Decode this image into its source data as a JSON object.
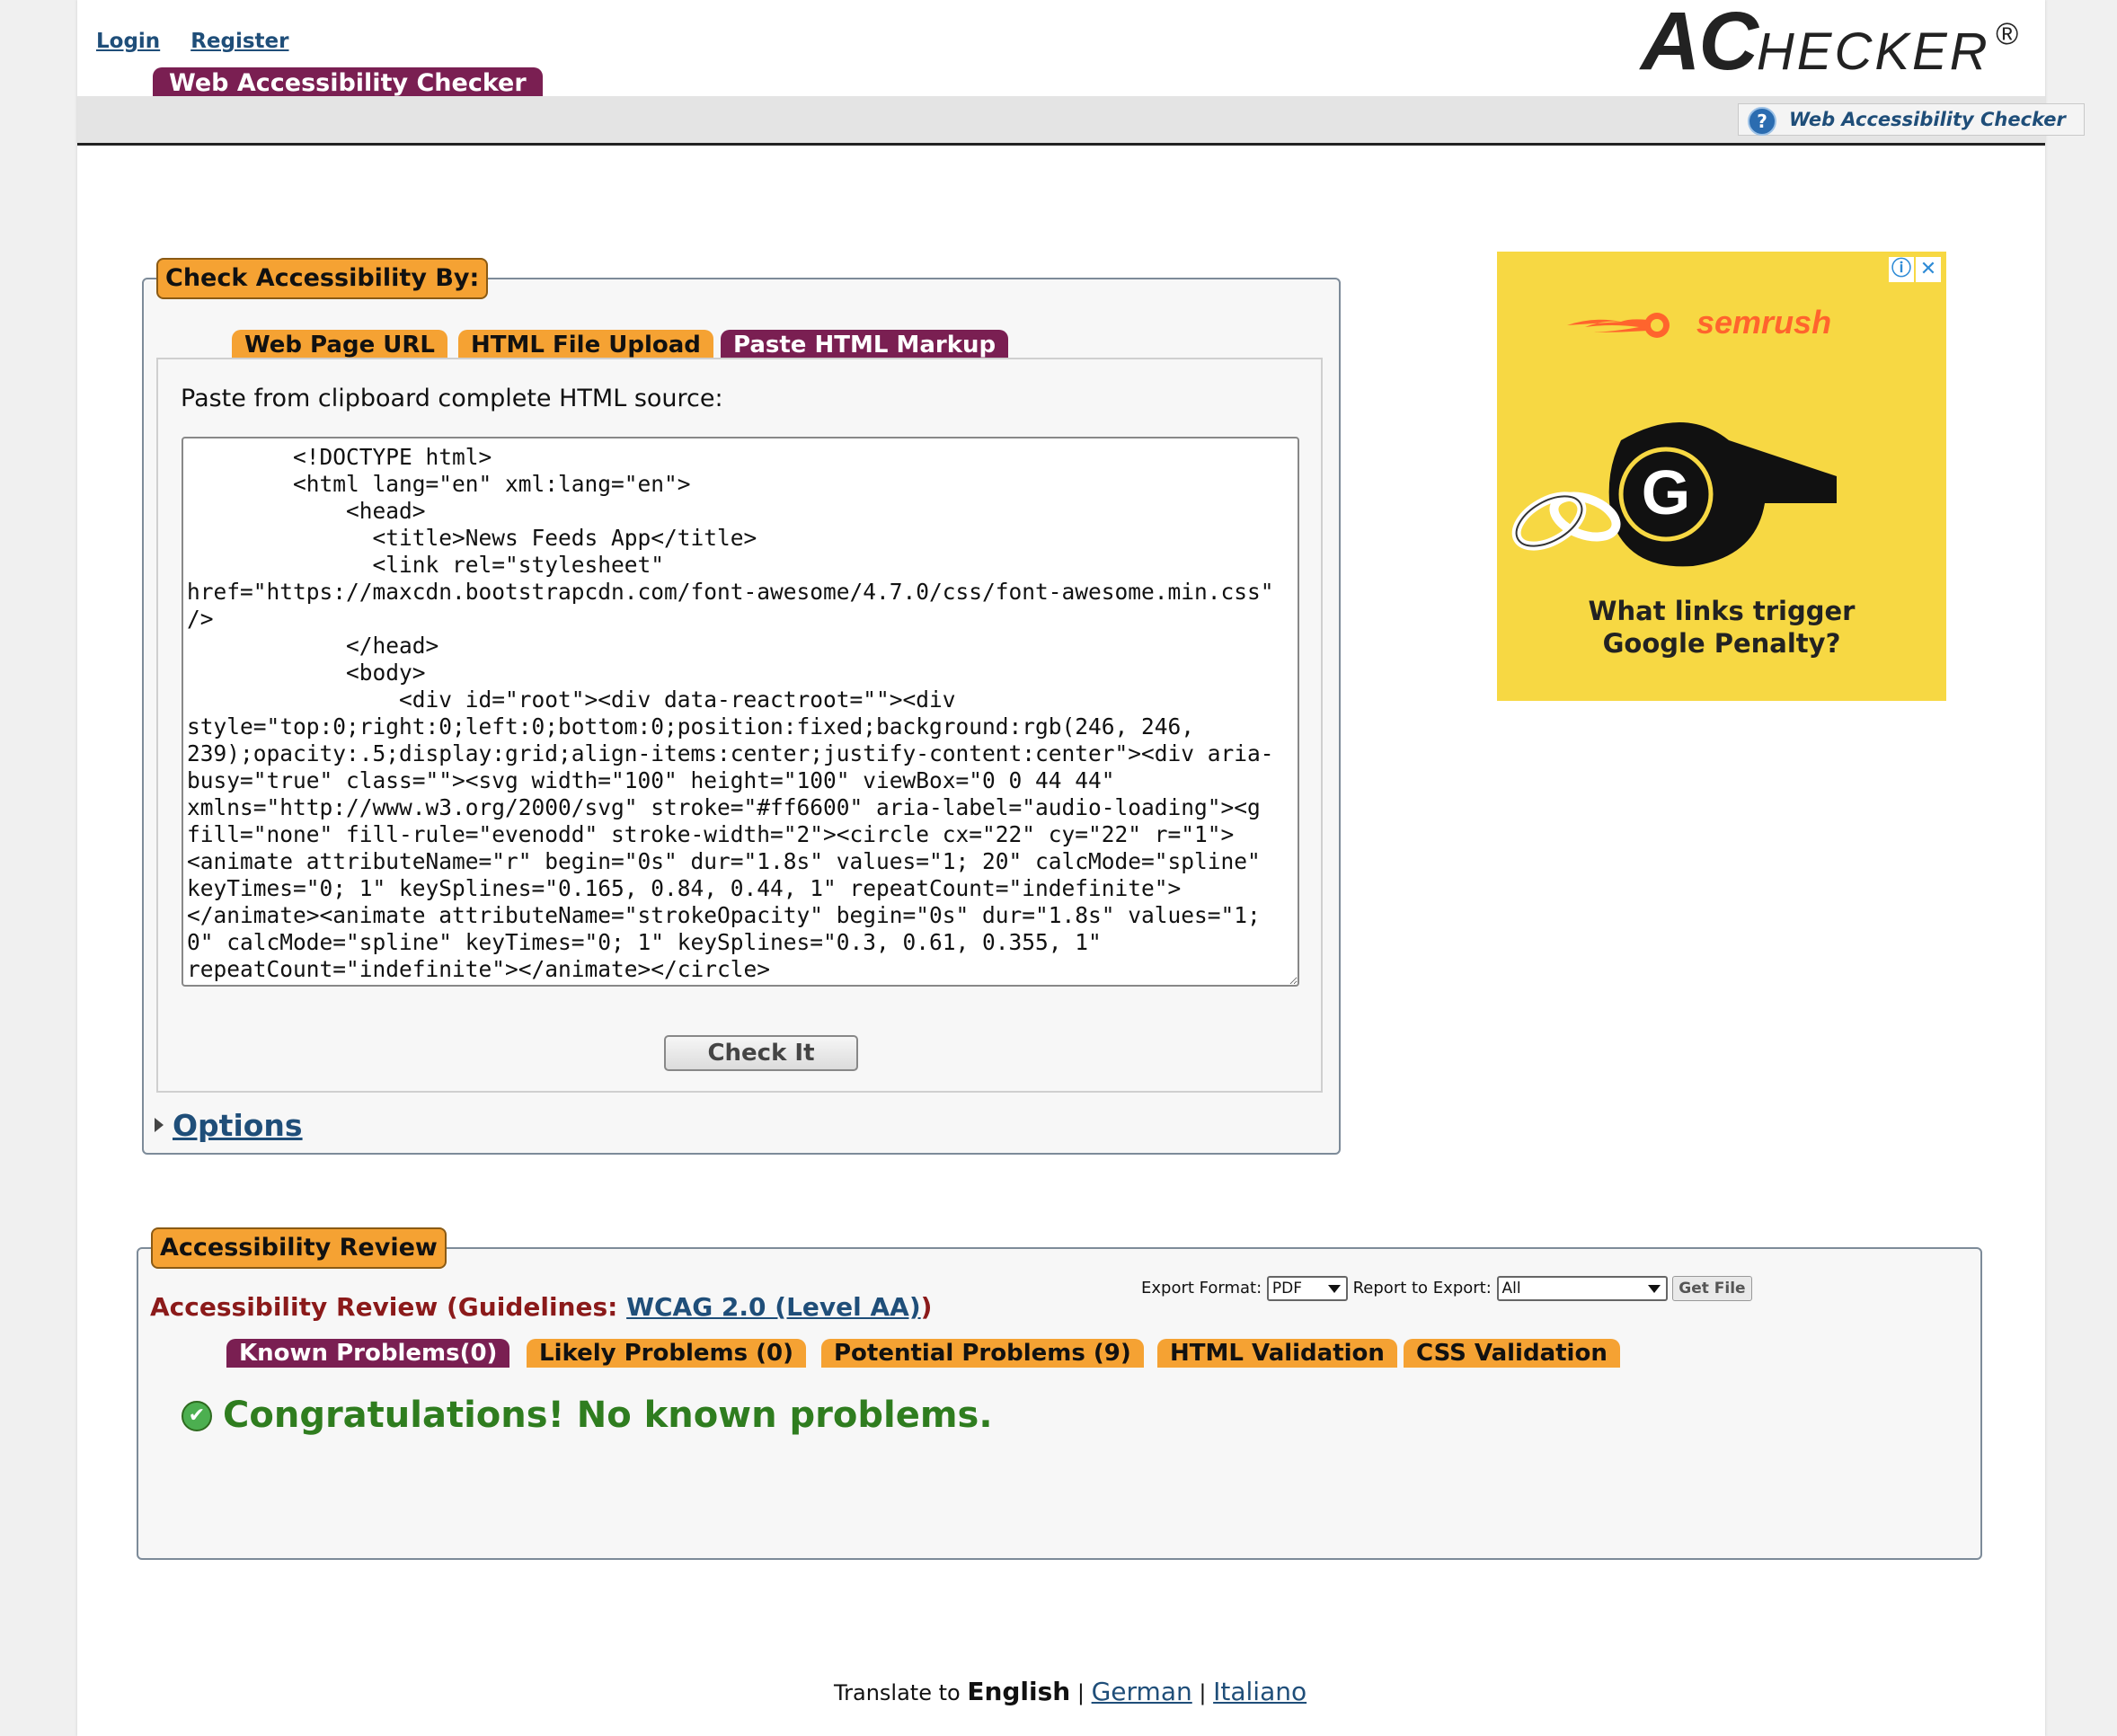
{
  "nav": {
    "login": "Login",
    "register": "Register"
  },
  "logo": {
    "ac": "AC",
    "hecker": "HECKER",
    "reg": "®"
  },
  "site_tab": "Web Accessibility Checker",
  "help_link": "Web Accessibility Checker",
  "check_by": {
    "legend": "Check Accessibility By:",
    "tabs": [
      {
        "label": "Web Page URL",
        "active": false
      },
      {
        "label": "HTML File Upload",
        "active": false
      },
      {
        "label": "Paste HTML Markup",
        "active": true
      }
    ],
    "paste_label": "Paste from clipboard complete HTML source:",
    "textarea_value": "        <!DOCTYPE html>\n        <html lang=\"en\" xml:lang=\"en\">\n            <head>\n              <title>News Feeds App</title>\n              <link rel=\"stylesheet\"\nhref=\"https://maxcdn.bootstrapcdn.com/font-awesome/4.7.0/css/font-awesome.min.css\" />\n            </head>\n            <body>\n                <div id=\"root\"><div data-reactroot=\"\"><div style=\"top:0;right:0;left:0;bottom:0;position:fixed;background:rgb(246, 246, 239);opacity:.5;display:grid;align-items:center;justify-content:center\"><div aria-busy=\"true\" class=\"\"><svg width=\"100\" height=\"100\" viewBox=\"0 0 44 44\" xmlns=\"http://www.w3.org/2000/svg\" stroke=\"#ff6600\" aria-label=\"audio-loading\"><g fill=\"none\" fill-rule=\"evenodd\" stroke-width=\"2\"><circle cx=\"22\" cy=\"22\" r=\"1\"><animate attributeName=\"r\" begin=\"0s\" dur=\"1.8s\" values=\"1; 20\" calcMode=\"spline\" keyTimes=\"0; 1\" keySplines=\"0.165, 0.84, 0.44, 1\" repeatCount=\"indefinite\"></animate><animate attributeName=\"strokeOpacity\" begin=\"0s\" dur=\"1.8s\" values=\"1; 0\" calcMode=\"spline\" keyTimes=\"0; 1\" keySplines=\"0.3, 0.61, 0.355, 1\" repeatCount=\"indefinite\"></animate></circle>",
    "check_button": "Check It",
    "options": "Options"
  },
  "ad": {
    "brand": "semrush",
    "text_line1": "What links trigger",
    "text_line2": "Google Penalty?",
    "info": "ⓘ",
    "close": "✕",
    "brand_color": "#ff642d",
    "bg_color": "#f7d843"
  },
  "review": {
    "legend": "Accessibility Review",
    "title_prefix": "Accessibility Review (Guidelines: ",
    "guideline_link": "WCAG 2.0 (Level AA)",
    "title_suffix": ")",
    "export_format_label": "Export Format:",
    "export_format_value": "PDF",
    "report_label": "Report to Export:",
    "report_value": "All",
    "get_file": "Get File",
    "tabs": [
      {
        "label": "Known Problems(0)",
        "active": true
      },
      {
        "label": "Likely Problems (0)",
        "active": false
      },
      {
        "label": "Potential Problems (9)",
        "active": false
      },
      {
        "label": "HTML Validation",
        "active": false
      },
      {
        "label": "CSS Validation",
        "active": false
      }
    ],
    "congrats": "Congratulations! No known problems."
  },
  "footer": {
    "translate": "Translate to ",
    "english": "English",
    "sep": "|",
    "german": "German",
    "italiano": "Italiano"
  },
  "colors": {
    "accent_orange": "#f5a233",
    "accent_purple": "#7a1f52",
    "link_blue": "#1f4e79",
    "success_green": "#2f7d1f",
    "review_red": "#8b1a1a"
  }
}
